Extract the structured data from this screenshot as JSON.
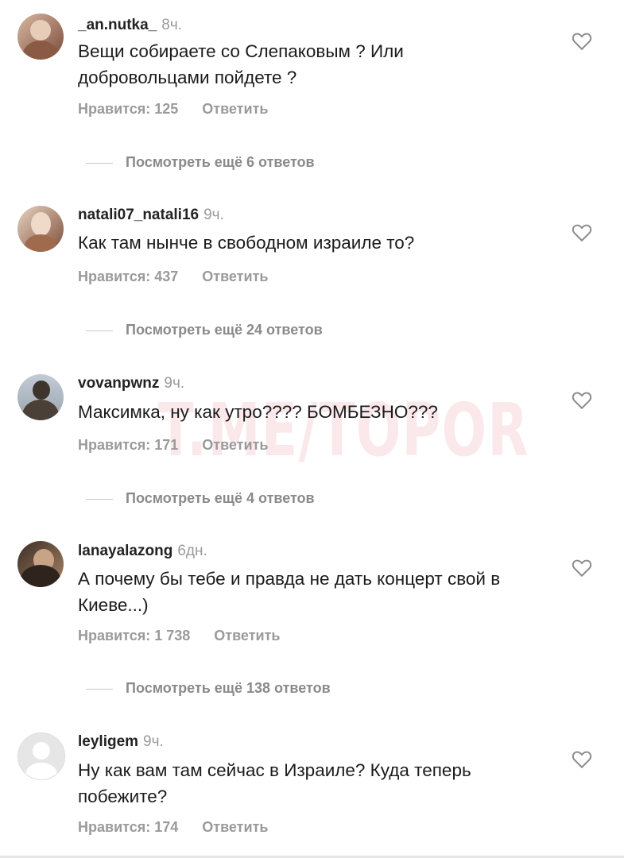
{
  "watermark": "T.ME/TOPOR",
  "comments": [
    {
      "username": "_an.nutka_",
      "time": "8ч.",
      "text": "Вещи собираете со Слепаковым ? Или добровольцами пойдете ?",
      "likes": "Нравится: 125",
      "reply": "Ответить",
      "more": "Посмотреть ещё 6 ответов",
      "avatar_colors": [
        "#c9a58e",
        "#7a4a3a"
      ]
    },
    {
      "username": "natali07_natali16",
      "time": "9ч.",
      "text": "Как там нынче в свободном израиле то?",
      "likes": "Нравится: 437",
      "reply": "Ответить",
      "more": "Посмотреть ещё 24 ответов",
      "avatar_colors": [
        "#d8b9a0",
        "#8d5b3f"
      ]
    },
    {
      "username": "vovanpwnz",
      "time": "9ч.",
      "text": "Максимка, ну как утро???? БОМБЕЗНО???",
      "likes": "Нравится: 171",
      "reply": "Ответить",
      "more": "Посмотреть ещё 4 ответов",
      "avatar_colors": [
        "#b8c2cf",
        "#3e3a34"
      ]
    },
    {
      "username": "lanayalazong",
      "time": "6дн.",
      "text": "А почему бы тебе и правда не дать концерт свой в Киеве...)",
      "likes": "Нравится: 1 738",
      "reply": "Ответить",
      "more": "Посмотреть ещё 138 ответов",
      "avatar_colors": [
        "#5a4636",
        "#c7a58a"
      ]
    },
    {
      "username": "leyligem",
      "time": "9ч.",
      "text": "Ну как вам там сейчас в Израиле? Куда теперь побежите?",
      "likes": "Нравится: 174",
      "reply": "Ответить",
      "more": "",
      "avatar_colors": [
        "#e4e4e4",
        "#ffffff"
      ]
    }
  ],
  "icons": {
    "like": "heart-outline-icon"
  }
}
